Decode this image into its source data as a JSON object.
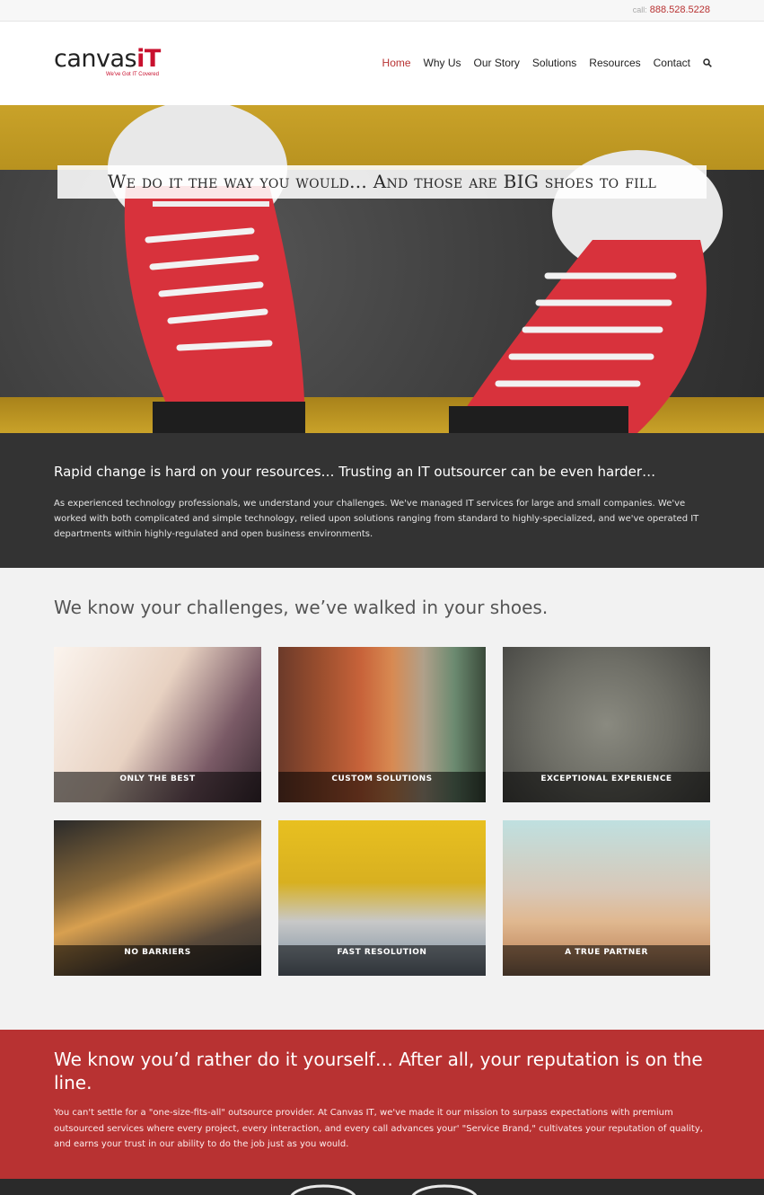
{
  "topbar": {
    "call_label": "call:",
    "phone": "888.528.5228"
  },
  "logo": {
    "word": "canvas",
    "it": "iT",
    "tagline": "We've Got IT Covered"
  },
  "nav": {
    "items": [
      "Home",
      "Why Us",
      "Our Story",
      "Solutions",
      "Resources",
      "Contact"
    ],
    "active": "Home",
    "search_icon": "search-icon"
  },
  "hero": {
    "banner": "We do it the way you would... And those are BIG shoes to fill"
  },
  "intro": {
    "heading": "Rapid change is hard on your resources… Trusting an IT outsourcer can be even harder…",
    "body": "As experienced technology professionals, we understand your challenges. We've managed IT services for large and small companies. We've worked with both complicated and simple technology, relied upon solutions ranging from standard to highly-specialized, and we've operated IT departments within highly-regulated and open business environments."
  },
  "challenges": {
    "heading": "We know your challenges, we’ve walked in your shoes.",
    "tiles": [
      "ONLY THE BEST",
      "CUSTOM SOLUTIONS",
      "EXCEPTIONAL EXPERIENCE",
      "NO BARRIERS",
      "FAST RESOLUTION",
      "A TRUE PARTNER"
    ]
  },
  "reputation": {
    "heading": "We know you’d rather do it yourself… After all, your reputation is on the line.",
    "body": "You can't settle for a \"one-size-fits-all\" outsource provider. At Canvas IT, we've made it our mission to surpass expectations with premium outsourced services where every project, every interaction, and every call advances your' \"Service Brand,\" cultivates your reputation of quality, and earns your trust in our ability to do the job just as you would."
  },
  "colors": {
    "accent": "#b83232",
    "dark": "#333333",
    "light": "#f2f2f2"
  }
}
